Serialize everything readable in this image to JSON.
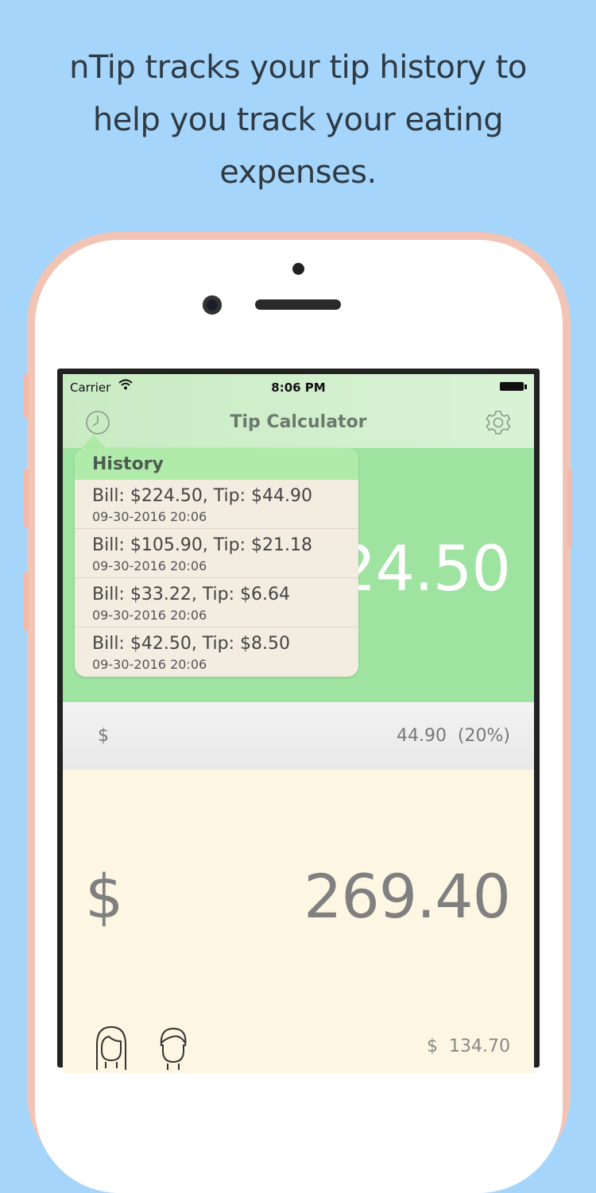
{
  "promo": {
    "line1": "nTip tracks your tip history to",
    "line2": "help you track your eating",
    "line3": "expenses."
  },
  "status_bar": {
    "carrier": "Carrier",
    "time": "8:06 PM"
  },
  "nav": {
    "title": "Tip Calculator",
    "left_icon": "clock-icon",
    "right_icon": "gear-icon"
  },
  "bill": {
    "amount_visible": "24.50"
  },
  "tip": {
    "currency": "$",
    "amount": "44.90  (20%)"
  },
  "total": {
    "currency": "$",
    "amount": "269.40",
    "per_person": "$  134.70"
  },
  "history": {
    "header": "History",
    "items": [
      {
        "summary": "Bill: $224.50, Tip: $44.90",
        "date": "09-30-2016 20:06"
      },
      {
        "summary": "Bill: $105.90, Tip: $21.18",
        "date": "09-30-2016 20:06"
      },
      {
        "summary": "Bill: $33.22, Tip: $6.64",
        "date": "09-30-2016 20:06"
      },
      {
        "summary": "Bill: $42.50, Tip: $8.50",
        "date": "09-30-2016 20:06"
      }
    ]
  },
  "colors": {
    "background": "#a6d5fb",
    "bill_bg": "#9fe3a0",
    "total_bg": "#fdf6e3",
    "phone_rose_gold": "#f2c4b5"
  }
}
